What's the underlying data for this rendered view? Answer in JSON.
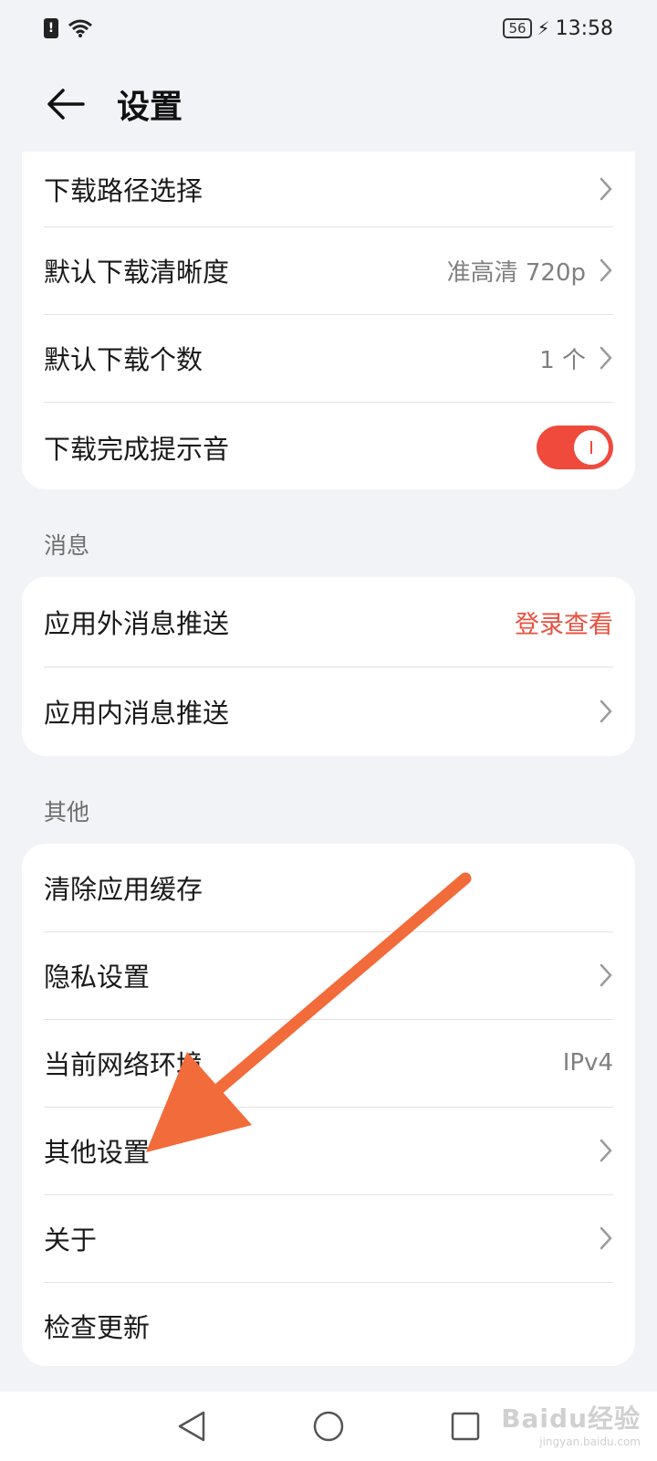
{
  "status_bar": {
    "battery_level": "56",
    "time": "13:58"
  },
  "header": {
    "title": "设置"
  },
  "download_card": {
    "rows": [
      {
        "label": "下载路径选择",
        "value": ""
      },
      {
        "label": "默认下载清晰度",
        "value": "准高清 720p"
      },
      {
        "label": "默认下载个数",
        "value": "1 个"
      },
      {
        "label": "下载完成提示音",
        "toggle_on": true
      }
    ]
  },
  "messages_section": {
    "title": "消息",
    "rows": [
      {
        "label": "应用外消息推送",
        "value": "登录查看"
      },
      {
        "label": "应用内消息推送",
        "value": ""
      }
    ]
  },
  "other_section": {
    "title": "其他",
    "rows": [
      {
        "label": "清除应用缓存",
        "value": ""
      },
      {
        "label": "隐私设置",
        "value": ""
      },
      {
        "label": "当前网络环境",
        "value": "IPv4"
      },
      {
        "label": "其他设置",
        "value": ""
      },
      {
        "label": "关于",
        "value": ""
      },
      {
        "label": "检查更新",
        "value": ""
      }
    ]
  },
  "colors": {
    "accent": "#ef4a3c",
    "background": "#f1f3f6",
    "annotation_arrow": "#f26b3a"
  },
  "watermark": {
    "logo": "Baidu经验",
    "url": "jingyan.baidu.com"
  }
}
